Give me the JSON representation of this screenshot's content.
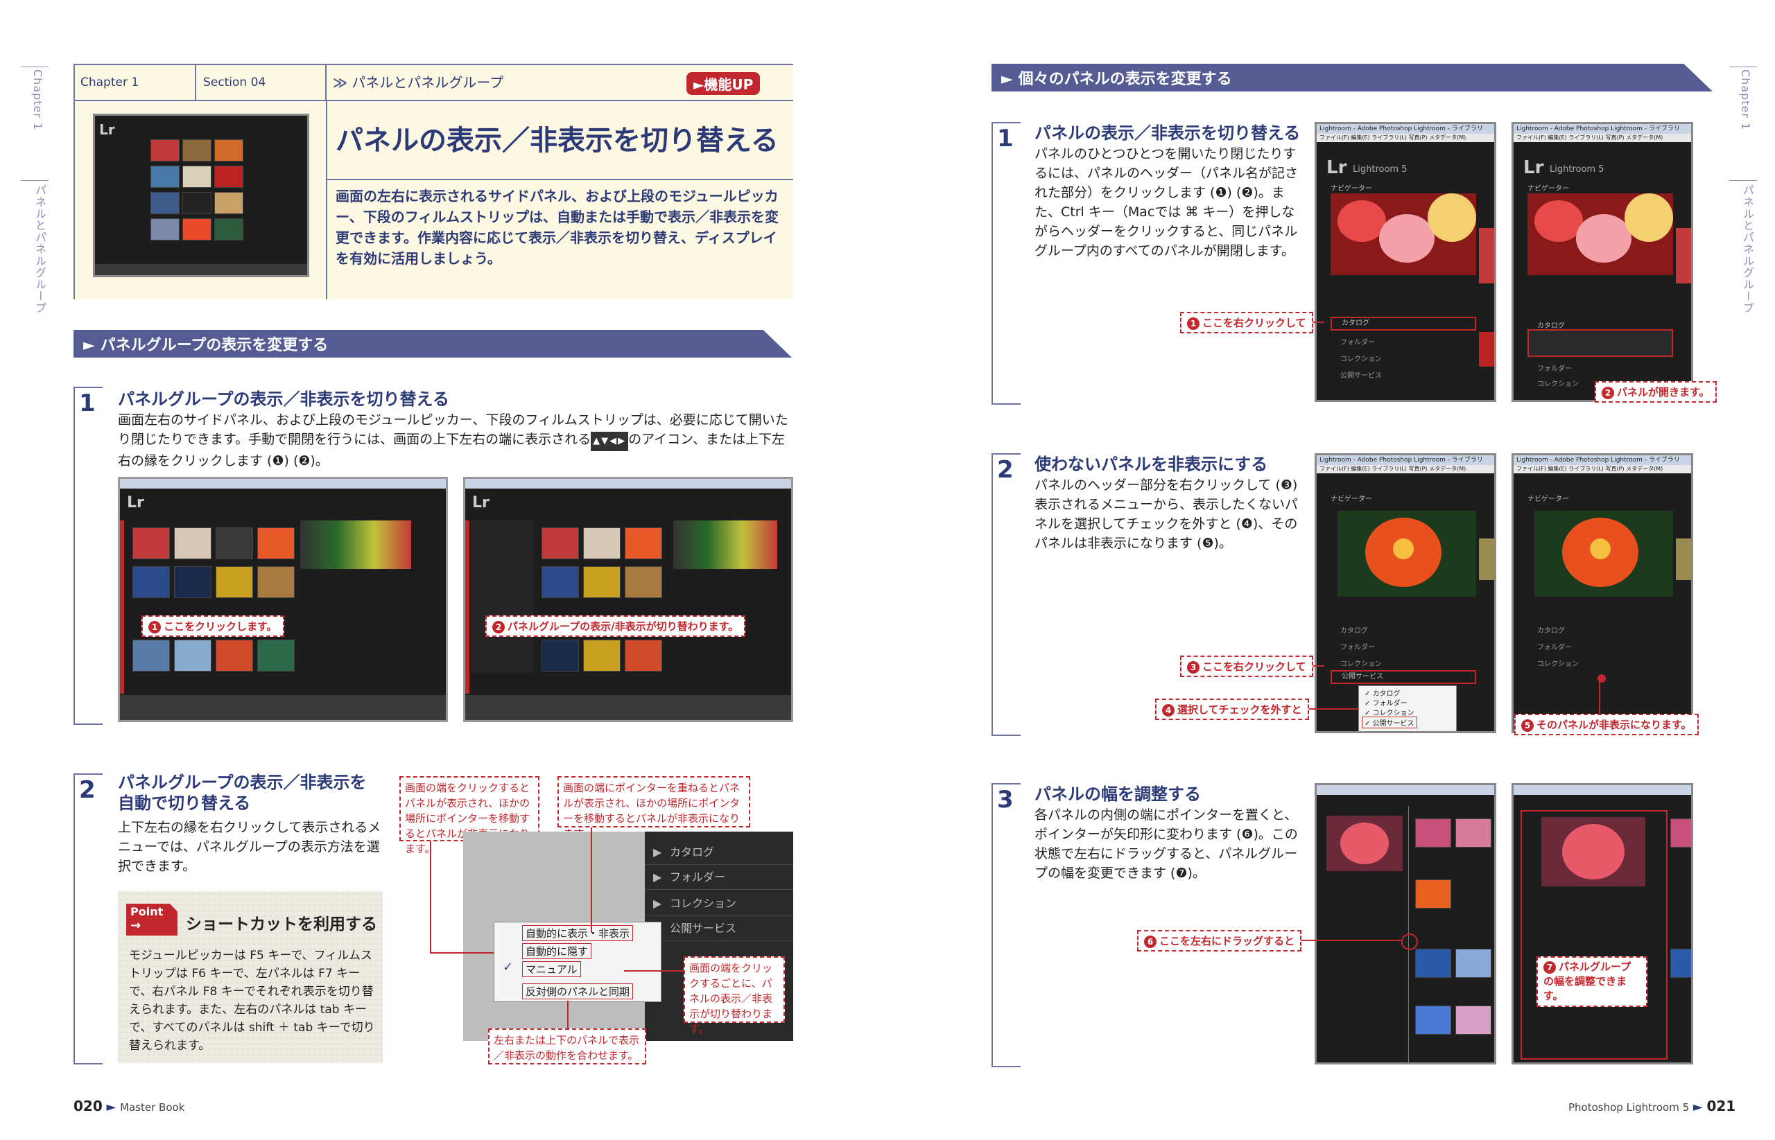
{
  "left_page": {
    "side_tab_chapter": "Chapter 1",
    "side_tab_section": "パネルとパネルグループ",
    "header": {
      "chapter": "Chapter 1",
      "section": "Section 04",
      "topic": "パネルとパネルグループ",
      "badge": "►機能UP"
    },
    "title": "パネルの表示／非表示を切り替える",
    "intro": "画面の左右に表示されるサイドパネル、および上段のモジュールピッカー、下段のフィルムストリップは、自動または手動で表示／非表示を変更できます。作業内容に応じて表示／非表示を切り替え、ディスプレイを有効に活用しましょう。",
    "section_bar": "► パネルグループの表示を変更する",
    "step1": {
      "num": "1",
      "title": "パネルグループの表示／非表示を切り替える",
      "text_a": "画面左右のサイドパネル、および上段のモジュールピッカー、下段のフィルムストリップは、必要に応じて開いたり閉じたりできます。手動で開閉を行うには、画面の上下左右の端に表示される",
      "text_b": "のアイコン、または上下左右の縁をクリックします (❶) (❷)。",
      "callout1": "ここをクリックします。",
      "callout2": "パネルグループの表示/非表示が切り替わります。",
      "lr_brand": "Lr"
    },
    "step2": {
      "num": "2",
      "title_line1": "パネルグループの表示／非表示を",
      "title_line2": "自動で切り替える",
      "text": "上下左右の縁を右クリックして表示されるメニューでは、パネルグループの表示方法を選択できます。",
      "note_a": "画面の端をクリックするとパネルが表示され、ほかの場所にポインターを移動するとパネルが非表示になります。",
      "note_b": "画面の端にポインターを重ねるとパネルが表示され、ほかの場所にポインターを移動するとパネルが非表示になります。",
      "note_c": "画面の端をクリックするごとに、パネルの表示／非表示が切り替わります。",
      "note_d": "左右または上下のパネルで表示／非表示の動作を合わせます。",
      "panel_items": [
        "カタログ",
        "フォルダー",
        "コレクション",
        "公開サービス"
      ],
      "menu_items": [
        "自動的に表示・非表示",
        "自動的に隠す",
        "マニュアル",
        "反対側のパネルと同期"
      ],
      "checkmark": "✓"
    },
    "point": {
      "label": "Point",
      "title": "ショートカットを利用する",
      "text": "モジュールピッカーは F5 キーで、フィルムストリップは F6 キーで、左パネルは F7 キーで、右パネル F8 キーでそれぞれ表示を切り替えられます。また、左右のパネルは tab キーで、すべてのパネルは shift ＋ tab キーで切り替えられます。"
    },
    "footer_page": "020",
    "footer_arrow": "►",
    "footer_title": "Master Book"
  },
  "right_page": {
    "side_tab_chapter": "Chapter 1",
    "side_tab_section": "パネルとパネルグループ",
    "section_bar": "► 個々のパネルの表示を変更する",
    "step1": {
      "num": "1",
      "title": "パネルの表示／非表示を切り替える",
      "text": "パネルのひとつひとつを開いたり閉じたりするには、パネルのヘッダー（パネル名が記された部分）をクリックします (❶) (❷)。また、Ctrl キー（Macでは ⌘ キー）を押しながらヘッダーをクリックすると、同じパネルグループ内のすべてのパネルが開閉します。",
      "callout1": "ここを右クリックして",
      "callout2": "パネルが開きます。",
      "shot_title": "Lightroom - Adobe Photoshop Lightroom - ライブラリ",
      "shot_menu": "ファイル(F)  編集(E)  ライブラリ(L)  写真(P)  メタデータ(M)",
      "lr_brand": "Lr",
      "lr_name": "Lightroom 5",
      "navigator": "ナビゲーター",
      "catalog": "カタログ",
      "folder": "フォルダー",
      "collection": "コレクション",
      "publish": "公開サービス"
    },
    "step2": {
      "num": "2",
      "title": "使わないパネルを非表示にする",
      "text": "パネルのヘッダー部分を右クリックして (❸) 表示されるメニューから、表示したくないパネルを選択してチェックを外すと (❹)、そのパネルは非表示になります (❺)。",
      "callout3": "ここを右クリックして",
      "callout4": "選択してチェックを外すと",
      "callout5": "そのパネルが非表示になります。"
    },
    "step3": {
      "num": "3",
      "title": "パネルの幅を調整する",
      "text": "各パネルの内側の端にポインターを置くと、ポインターが矢印形に変わります (❻)。この状態で左右にドラッグすると、パネルグループの幅を変更できます (❼)。",
      "callout6": "ここを左右にドラッグすると",
      "callout7": "パネルグループの幅を調整できます。"
    },
    "footer_title": "Photoshop Lightroom 5",
    "footer_arrow": "►",
    "footer_page": "021"
  },
  "colors": {
    "navy": "#2c3a78",
    "bar": "#545c93",
    "accent_red": "#c2272d",
    "cream": "#fdf8e1"
  }
}
